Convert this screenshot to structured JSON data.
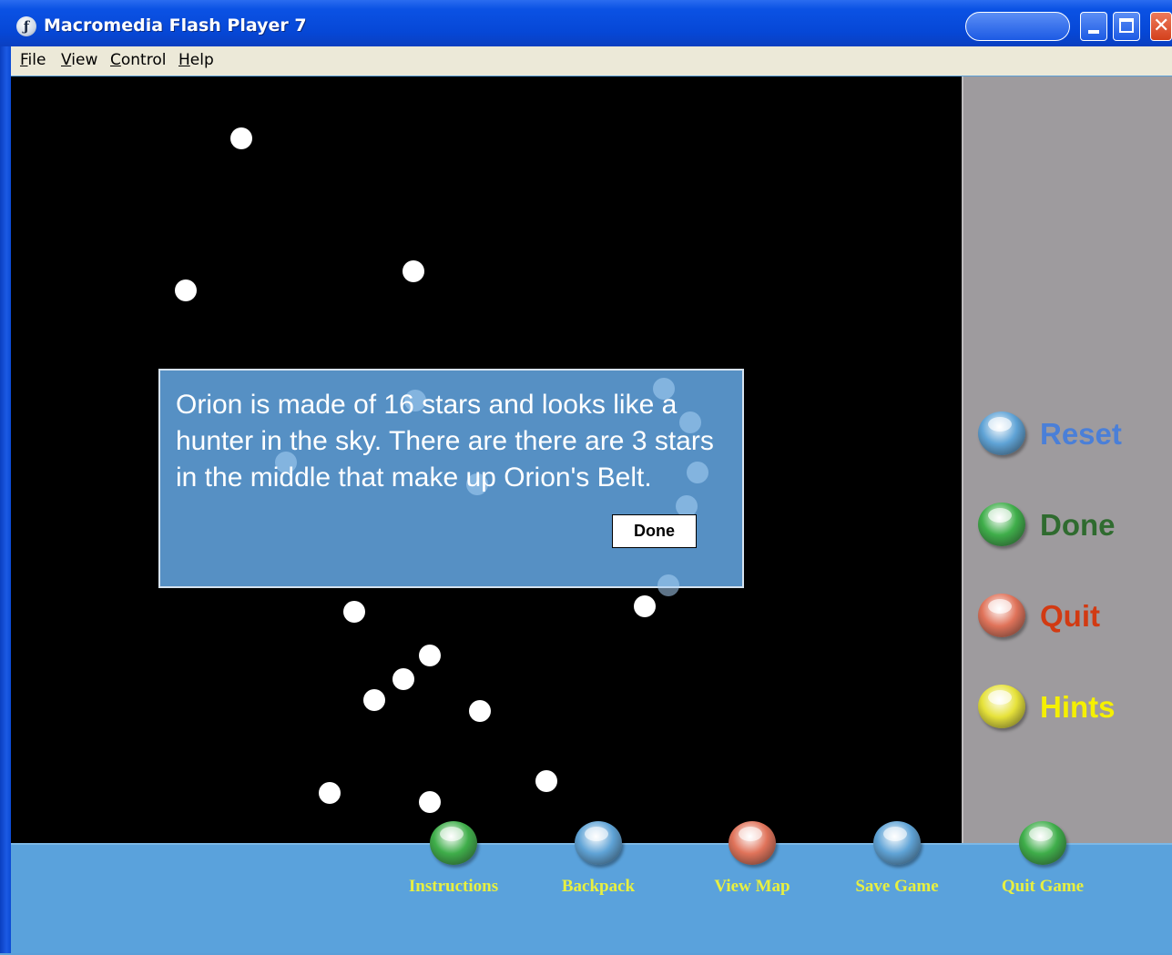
{
  "window": {
    "title": "Macromedia Flash Player 7",
    "icon": "flash-player-icon"
  },
  "menu": {
    "items": [
      "File",
      "View",
      "Control",
      "Help"
    ]
  },
  "dialog": {
    "text": "Orion is made of 16 stars and looks like a hunter in the sky. There are there are 3 stars in the middle that make up Orion's Belt.",
    "done_label": "Done"
  },
  "side_buttons": [
    {
      "label": "Reset",
      "color": "#4a7fd8",
      "gem": "#5fa3d6"
    },
    {
      "label": "Done",
      "color": "#2f6b2f",
      "gem": "#3fae4a"
    },
    {
      "label": "Quit",
      "color": "#d23a12",
      "gem": "#e0735a"
    },
    {
      "label": "Hints",
      "color": "#f5f000",
      "gem": "#e6e23a"
    }
  ],
  "nav": [
    {
      "label": "Instructions",
      "gem": "#3fae4a"
    },
    {
      "label": "Backpack",
      "gem": "#5fa3d6"
    },
    {
      "label": "View Map",
      "gem": "#e0735a"
    },
    {
      "label": "Save Game",
      "gem": "#5fa3d6"
    },
    {
      "label": "Quit Game",
      "gem": "#3fae4a"
    }
  ]
}
